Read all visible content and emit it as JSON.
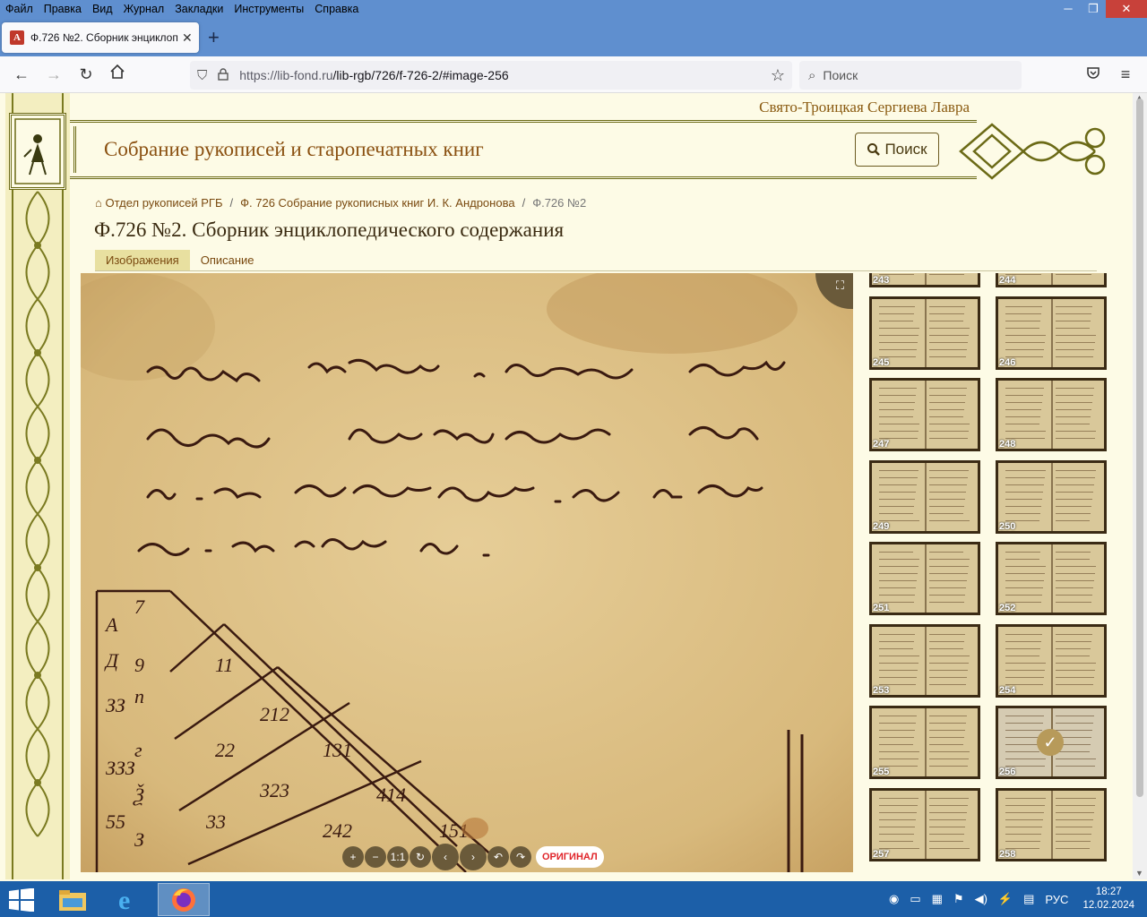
{
  "browser": {
    "menu": [
      "Файл",
      "Правка",
      "Вид",
      "Журнал",
      "Закладки",
      "Инструменты",
      "Справка"
    ],
    "tab_title": "Ф.726 №2. Сборник энциклопе",
    "url_host": "https://lib-fond.ru",
    "url_path": "/lib-rgb/726/f-726-2/#image-256",
    "search_placeholder": "Поиск"
  },
  "site": {
    "monastery": "Свято-Троицкая Сергиева Лавра",
    "title": "Собрание рукописей и старопечатных книг",
    "search_button": "Поиск"
  },
  "breadcrumb": {
    "home": "Отдел рукописей РГБ",
    "fond": "Ф. 726 Собрание рукописных книг И. К. Андронова",
    "current": "Ф.726 №2"
  },
  "document": {
    "title": "Ф.726 №2. Сборник энциклопедического содержания",
    "tabs": [
      "Изображения",
      "Описание"
    ]
  },
  "viewer": {
    "original_label": "ОРИГИНАЛ"
  },
  "thumbnails": [
    "243",
    "244",
    "245",
    "246",
    "247",
    "248",
    "249",
    "250",
    "251",
    "252",
    "253",
    "254",
    "255",
    "256",
    "257",
    "258"
  ],
  "selected_thumbnail": "256",
  "taskbar": {
    "lang": "РУС",
    "time": "18:27",
    "date": "12.02.2024"
  }
}
